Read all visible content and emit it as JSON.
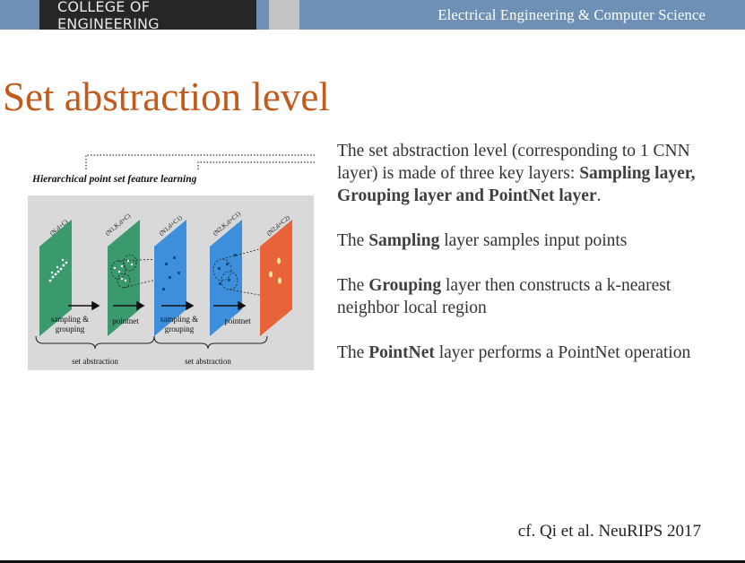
{
  "header": {
    "left_label": "COLLEGE OF ENGINEERING",
    "right_label": "Electrical Engineering & Computer Science",
    "bar_color": "#6e90b4"
  },
  "slide": {
    "title": "Set abstraction level",
    "title_color": "#c25a1b",
    "citation": "cf. Qi et al. NeuRIPS 2017"
  },
  "figure": {
    "title": "Hierarchical point set feature learning",
    "layer_labels": [
      "(N,d+C)",
      "(N1,K,d+C)",
      "(N1,d+C1)",
      "(N2,K,d+C1)",
      "(N2,d+C2)"
    ],
    "step_labels": {
      "sampling_grouping_1": [
        "sampling &",
        "grouping"
      ],
      "pointnet_1": "pointnet",
      "sampling_grouping_2": [
        "sampling &",
        "grouping"
      ],
      "pointnet_2": "pointnet"
    },
    "group_labels": [
      "set abstraction",
      "set abstraction"
    ],
    "colors": {
      "green": "#3b9a6d",
      "blue": "#3d8fdc",
      "orange": "#e8623a"
    }
  },
  "body": {
    "p1_text": "The set abstraction level (corresponding to 1 CNN layer) is made of three key layers: ",
    "p1_bold": "Sampling layer, Grouping layer and PointNet layer",
    "p1_end": ".",
    "p2_pre": "The ",
    "p2_bold": "Sampling",
    "p2_post": " layer samples input points",
    "p3_pre": "The ",
    "p3_bold": "Grouping",
    "p3_post": " layer then constructs a k-nearest neighbor local region",
    "p4_pre": "The ",
    "p4_bold": "PointNet",
    "p4_post": " layer performs a PointNet operation"
  }
}
